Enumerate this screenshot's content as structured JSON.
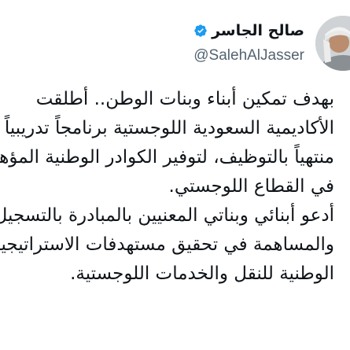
{
  "author": {
    "display_name": "صالح الجاسر",
    "handle": "@SalehAlJasser",
    "avatar_icon": "profile-photo",
    "verified_icon": "verified-badge-icon",
    "verified_color": "#1d9bf0"
  },
  "tweet": {
    "lines": [
      "بهدف تمكين أبناء وبنات الوطن.. أطلقت",
      "الأكاديمية السعودية اللوجستية برنامجاً تدريبياً",
      "منتهياً بالتوظيف، لتوفير الكوادر الوطنية المؤهلة",
      "في القطاع اللوجستي.",
      "أدعو أبنائي وبناتي المعنيين بالمبادرة بالتسجيل",
      "والمساهمة في تحقيق مستهدفات الاستراتيجية",
      "الوطنية للنقل والخدمات اللوجستية."
    ]
  },
  "colors": {
    "text": "#0f1419",
    "secondary_text": "#536471",
    "background": "#ffffff"
  }
}
